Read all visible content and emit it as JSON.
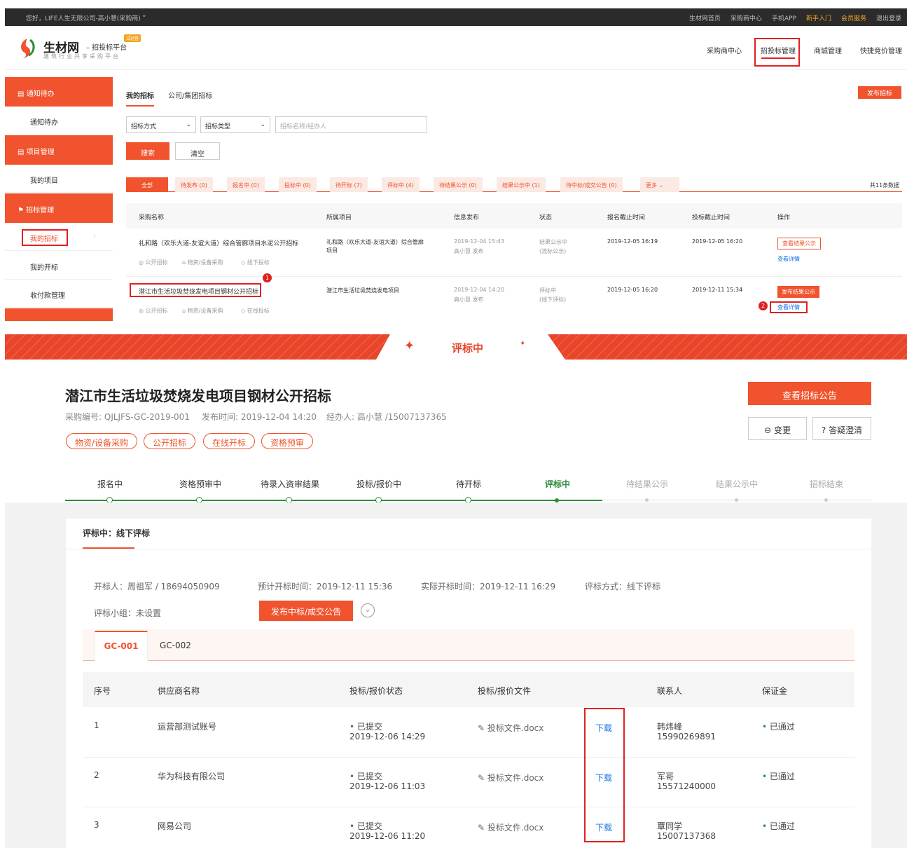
{
  "topbar": {
    "greeting": "您好，LIFE人生无限公司-高小慧(采购商)",
    "links": [
      "生材网首页",
      "采购商中心",
      "手机APP",
      "新手入门",
      "会员服务",
      "退出登录"
    ]
  },
  "header": {
    "logo_name": "生材网",
    "logo_tagline": "– 招投标平台",
    "logo_sub": "建筑行业共享采购平台",
    "logo_badge": "试运营",
    "nav": [
      "采购商中心",
      "招投标管理",
      "商城管理",
      "快捷竞价管理"
    ]
  },
  "sidebar": {
    "sections": [
      {
        "title": "通知待办",
        "items": [
          "通知待办"
        ]
      },
      {
        "title": "项目管理",
        "items": [
          "我的项目"
        ]
      },
      {
        "title": "招标管理",
        "items": [
          "我的招标",
          "我的开标",
          "收付款管理"
        ]
      }
    ]
  },
  "main": {
    "tabs": [
      "我的招标",
      "公司/集团招标"
    ],
    "publish_button": "发布招标",
    "filter_method": "招标方式",
    "filter_type": "招标类型",
    "search_placeholder": "招标名称/经办人",
    "search_button": "搜索",
    "clear_button": "清空",
    "status_tabs": [
      "全部",
      "待发布 (0)",
      "报名中 (0)",
      "投标中 (0)",
      "待开标 (7)",
      "评标中 (4)",
      "待结果公示 (0)",
      "结果公示中 (1)",
      "待中标/成交公告 (0)",
      "更多"
    ],
    "total": "共11条数据",
    "columns": [
      "采购名称",
      "所属项目",
      "信息发布",
      "状态",
      "报名截止时间",
      "投标截止时间",
      "操作"
    ],
    "rows": [
      {
        "name": "礼和路（欢乐大道-友谊大道）综合管廊项目水泥公开招标",
        "tags": [
          "公开招标",
          "物资/设备采购",
          "线下投标"
        ],
        "project": "礼和路（欢乐大道-友谊大道）综合管廊项目",
        "publish_time": "2019-12-04 15:43",
        "publisher": "高小慧 发布",
        "status": "结果公示中",
        "status_sub": "(流标公示)",
        "signup_deadline": "2019-12-05 16:19",
        "bid_deadline": "2019-12-05 16:20",
        "action_main": "查看结果公示",
        "action_link": "查看详情"
      },
      {
        "name": "潜江市生活垃圾焚烧发电项目钢材公开招标",
        "tags": [
          "公开招标",
          "物资/设备采购",
          "在线投标"
        ],
        "project": "潜江市生活垃圾焚烧发电项目",
        "publish_time": "2019-12-04 14:20",
        "publisher": "高小慧 发布",
        "status": "评标中",
        "status_sub": "(线下评标)",
        "signup_deadline": "2019-12-05 16:20",
        "bid_deadline": "2019-12-11 15:34",
        "action_main": "发布结果公示",
        "action_link": "查看详情"
      }
    ],
    "markers": [
      "1",
      "2"
    ]
  },
  "detail": {
    "banner_title": "评标中",
    "title": "潜江市生活垃圾焚烧发电项目钢材公开招标",
    "code_label": "采购编号:",
    "code": "QJLJFS-GC-2019-001",
    "time_label": "发布时间:",
    "time": "2019-12-04 14:20",
    "agent_label": "经办人:",
    "agent": "高小慧 /15007137365",
    "pills": [
      "物资/设备采购",
      "公开招标",
      "在线开标",
      "资格预审"
    ],
    "view_notice_button": "查看招标公告",
    "change_button": "变更",
    "qa_button": "答疑澄清",
    "steps": [
      "报名中",
      "资格预审中",
      "待录入资审结果",
      "投标/报价中",
      "待开标",
      "评标中",
      "待结果公示",
      "结果公示中",
      "招标结束"
    ],
    "stage_title": "评标中：线下评标",
    "opener": "开标人：周祖军 / 18694050909",
    "planned_open": "预计开标时间：2019-12-11 15:36",
    "actual_open": "实际开标时间：2019-12-11 16:29",
    "eval_method": "评标方式：线下评标",
    "eval_group": "评标小组：未设置",
    "publish_award_button": "发布中标/成交公告",
    "lot_tabs": [
      "GC-001",
      "GC-002"
    ],
    "table_columns": [
      "序号",
      "供应商名称",
      "投标/报价状态",
      "投标/报价文件",
      "",
      "联系人",
      "保证金"
    ],
    "table_rows": [
      {
        "no": "1",
        "supplier": "运营部测试账号",
        "status": "已提交",
        "time": "2019-12-06 14:29",
        "file": "投标文件.docx",
        "download": "下载",
        "contact": "韩炜峰",
        "phone": "15990269891",
        "deposit": "已通过"
      },
      {
        "no": "2",
        "supplier": "华为科技有限公司",
        "status": "已提交",
        "time": "2019-12-06 11:03",
        "file": "投标文件.docx",
        "download": "下载",
        "contact": "军哥",
        "phone": "15571240000",
        "deposit": "已通过"
      },
      {
        "no": "3",
        "supplier": "网易公司",
        "status": "已提交",
        "time": "2019-12-06 11:20",
        "file": "投标文件.docx",
        "download": "下载",
        "contact": "覃同学",
        "phone": "15007137368",
        "deposit": "已通过"
      }
    ]
  },
  "colors": {
    "accent": "#f0532d",
    "green": "#2e8b3a",
    "highlight": "#e02020"
  }
}
